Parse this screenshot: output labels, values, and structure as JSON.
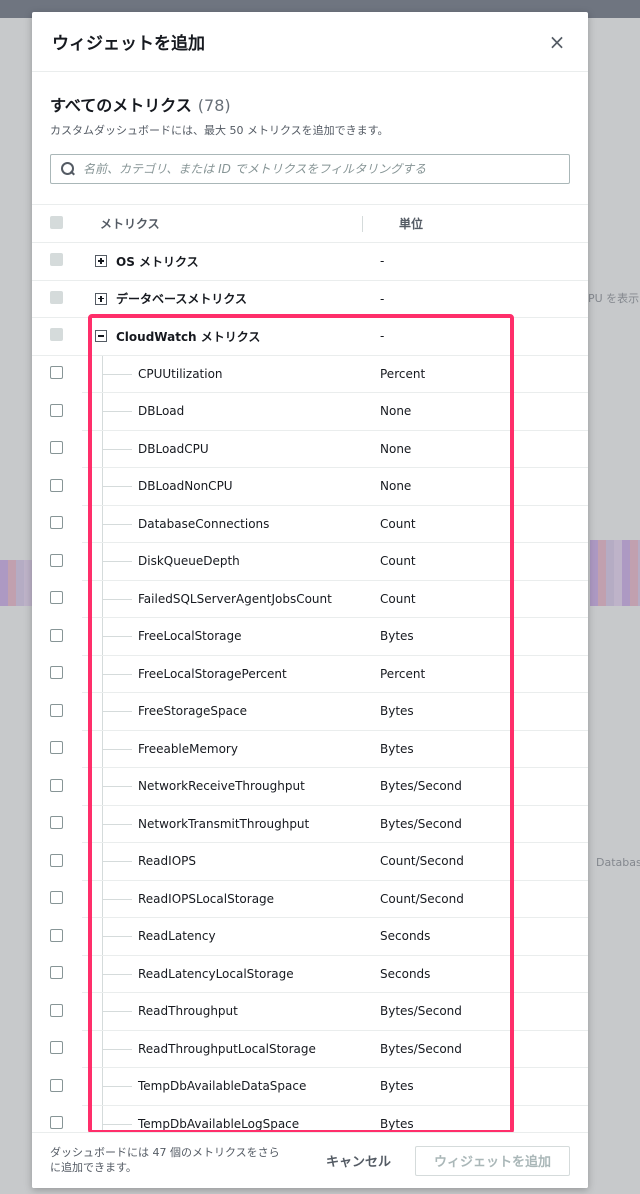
{
  "modal": {
    "title": "ウィジェットを追加",
    "close_icon": "×"
  },
  "section": {
    "title": "すべてのメトリクス",
    "count": "(78)",
    "description": "カスタムダッシュボードには、最大 50 メトリクスを追加できます。"
  },
  "search": {
    "placeholder": "名前、カテゴリ、または ID でメトリクスをフィルタリングする",
    "value": ""
  },
  "table": {
    "headers": {
      "name": "メトリクス",
      "unit": "単位"
    },
    "groups": [
      {
        "name": "OS メトリクス",
        "unit": "-",
        "expanded": false
      },
      {
        "name": "データベースメトリクス",
        "unit": "-",
        "expanded": false
      },
      {
        "name": "CloudWatch メトリクス",
        "unit": "-",
        "expanded": true
      }
    ],
    "metrics": [
      {
        "name": "CPUUtilization",
        "unit": "Percent"
      },
      {
        "name": "DBLoad",
        "unit": "None"
      },
      {
        "name": "DBLoadCPU",
        "unit": "None"
      },
      {
        "name": "DBLoadNonCPU",
        "unit": "None"
      },
      {
        "name": "DatabaseConnections",
        "unit": "Count"
      },
      {
        "name": "DiskQueueDepth",
        "unit": "Count"
      },
      {
        "name": "FailedSQLServerAgentJobsCount",
        "unit": "Count"
      },
      {
        "name": "FreeLocalStorage",
        "unit": "Bytes"
      },
      {
        "name": "FreeLocalStoragePercent",
        "unit": "Percent"
      },
      {
        "name": "FreeStorageSpace",
        "unit": "Bytes"
      },
      {
        "name": "FreeableMemory",
        "unit": "Bytes"
      },
      {
        "name": "NetworkReceiveThroughput",
        "unit": "Bytes/Second"
      },
      {
        "name": "NetworkTransmitThroughput",
        "unit": "Bytes/Second"
      },
      {
        "name": "ReadIOPS",
        "unit": "Count/Second"
      },
      {
        "name": "ReadIOPSLocalStorage",
        "unit": "Count/Second"
      },
      {
        "name": "ReadLatency",
        "unit": "Seconds"
      },
      {
        "name": "ReadLatencyLocalStorage",
        "unit": "Seconds"
      },
      {
        "name": "ReadThroughput",
        "unit": "Bytes/Second"
      },
      {
        "name": "ReadThroughputLocalStorage",
        "unit": "Bytes/Second"
      },
      {
        "name": "TempDbAvailableDataSpace",
        "unit": "Bytes"
      },
      {
        "name": "TempDbAvailableLogSpace",
        "unit": "Bytes"
      }
    ]
  },
  "footer": {
    "note": "ダッシュボードには 47 個のメトリクスをさらに追加できます。",
    "cancel_label": "キャンセル",
    "add_label": "ウィジェットを追加"
  },
  "background": {
    "hint_right": "PU を表示",
    "hint_right2": "Databas"
  },
  "colors": {
    "highlight": "#ff2e6a",
    "border": "#eaeded",
    "muted_text": "#545b64"
  }
}
